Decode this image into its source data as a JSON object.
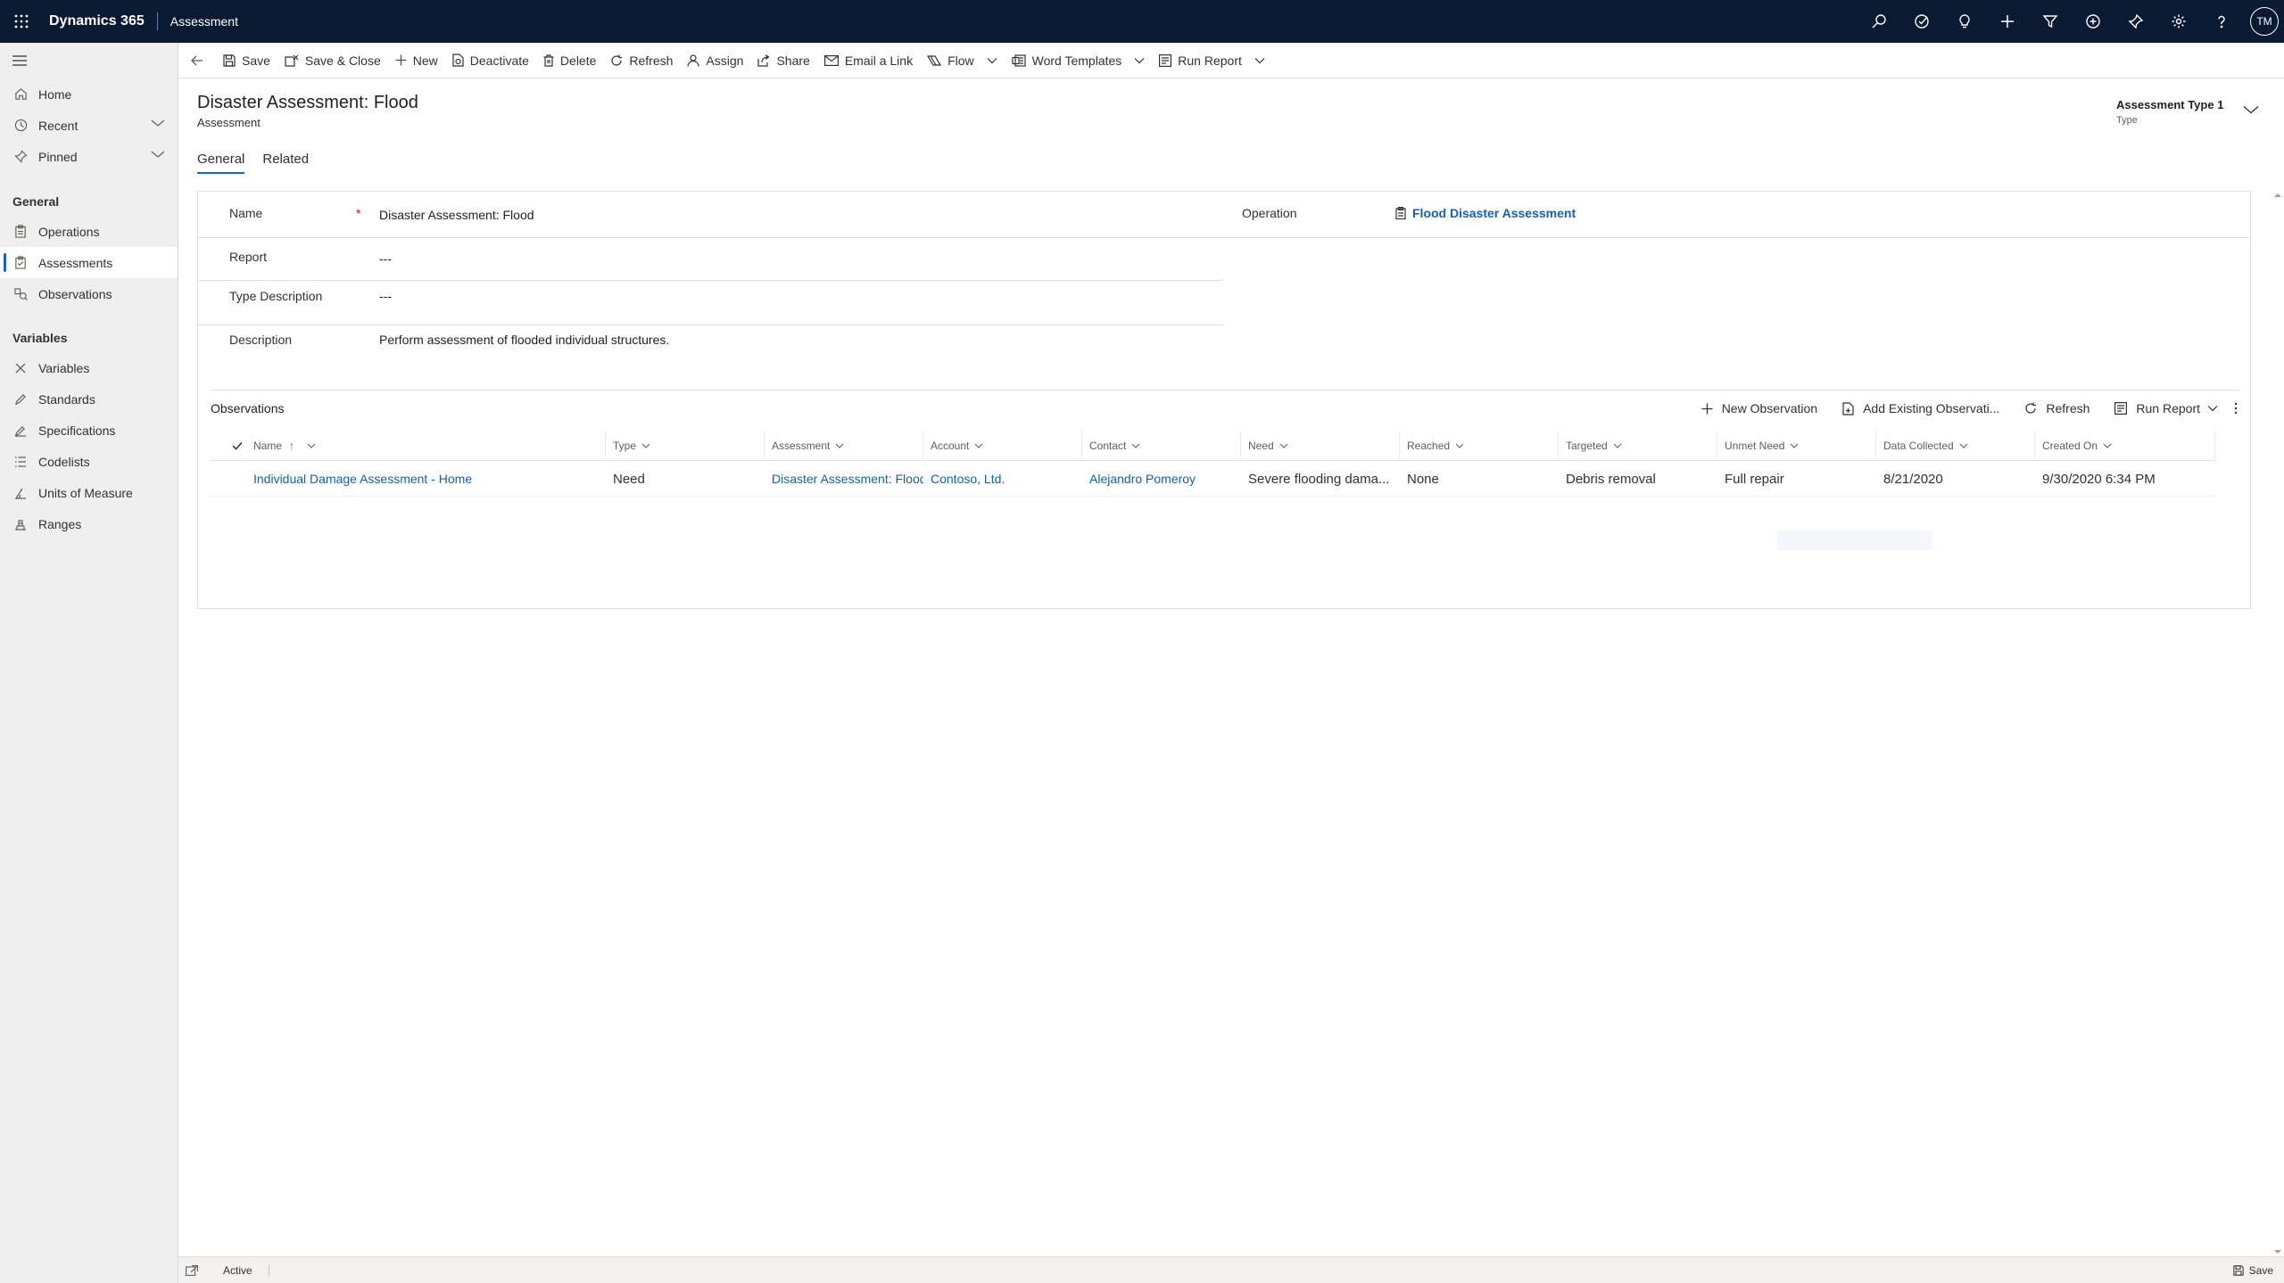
{
  "topbar": {
    "app_name": "Dynamics 365",
    "entity": "Assessment",
    "icons": [
      "search-icon",
      "task-icon",
      "lightbulb-icon",
      "plus-icon",
      "filter-icon",
      "add-circle-icon",
      "pin-icon",
      "gear-icon",
      "help-icon"
    ],
    "avatar_initials": "TM"
  },
  "sidebar": {
    "top_items": [
      {
        "label": "Home",
        "icon": "home-icon"
      },
      {
        "label": "Recent",
        "icon": "clock-icon"
      },
      {
        "label": "Pinned",
        "icon": "pin-icon"
      }
    ],
    "groups": [
      {
        "label": "General",
        "items": [
          {
            "label": "Operations",
            "icon": "clipboard-icon"
          },
          {
            "label": "Assessments",
            "icon": "assessment-icon",
            "active": true
          },
          {
            "label": "Observations",
            "icon": "observation-icon"
          }
        ]
      },
      {
        "label": "Variables",
        "items": [
          {
            "label": "Variables",
            "icon": "variable-icon"
          },
          {
            "label": "Standards",
            "icon": "pen-icon"
          },
          {
            "label": "Specifications",
            "icon": "specification-icon"
          },
          {
            "label": "Codelists",
            "icon": "list-icon"
          },
          {
            "label": "Units of Measure",
            "icon": "ruler-icon"
          },
          {
            "label": "Ranges",
            "icon": "range-icon"
          }
        ]
      }
    ]
  },
  "commandbar": {
    "items": [
      {
        "label": "Save",
        "icon": "save-icon"
      },
      {
        "label": "Save & Close",
        "icon": "save-close-icon"
      },
      {
        "label": "New",
        "icon": "plus-icon"
      },
      {
        "label": "Deactivate",
        "icon": "deactivate-icon"
      },
      {
        "label": "Delete",
        "icon": "trash-icon"
      },
      {
        "label": "Refresh",
        "icon": "refresh-icon"
      },
      {
        "label": "Assign",
        "icon": "person-icon"
      },
      {
        "label": "Share",
        "icon": "share-icon"
      },
      {
        "label": "Email a Link",
        "icon": "mail-icon"
      },
      {
        "label": "Flow",
        "icon": "flow-icon"
      },
      {
        "label": "Word Templates",
        "icon": "word-icon"
      },
      {
        "label": "Run Report",
        "icon": "report-icon"
      }
    ]
  },
  "record": {
    "title": "Disaster Assessment: Flood",
    "entity_label": "Assessment",
    "header_field_value": "Assessment Type 1",
    "header_field_label": "Type"
  },
  "tabs": [
    {
      "label": "General",
      "active": true
    },
    {
      "label": "Related",
      "active": false
    }
  ],
  "form": {
    "name_label": "Name",
    "name_required_marker": "*",
    "name_value": "Disaster Assessment: Flood",
    "report_label": "Report",
    "report_value": "---",
    "type_description_label": "Type Description",
    "type_description_value": "---",
    "description_label": "Description",
    "description_value": "Perform assessment of flooded individual structures.",
    "operation_label": "Operation",
    "operation_value": "Flood Disaster Assessment"
  },
  "observations": {
    "title": "Observations",
    "commands": {
      "new": "New Observation",
      "add_existing": "Add Existing Observati...",
      "refresh": "Refresh",
      "run_report": "Run Report"
    },
    "columns": [
      {
        "label": "Name",
        "sort": "↑"
      },
      {
        "label": "Type"
      },
      {
        "label": "Assessment"
      },
      {
        "label": "Account"
      },
      {
        "label": "Contact"
      },
      {
        "label": "Need"
      },
      {
        "label": "Reached"
      },
      {
        "label": "Targeted"
      },
      {
        "label": "Unmet Need"
      },
      {
        "label": "Data Collected"
      },
      {
        "label": "Created On"
      }
    ],
    "rows": [
      {
        "name": "Individual Damage Assessment - Home",
        "type": "Need",
        "assessment": "Disaster Assessment: Flood",
        "account": "Contoso, Ltd.",
        "contact": "Alejandro Pomeroy",
        "need": "Severe flooding dama...",
        "reached": "None",
        "targeted": "Debris removal",
        "unmet_need": "Full repair",
        "data_collected": "8/21/2020",
        "created_on": "9/30/2020 6:34 PM"
      }
    ]
  },
  "footer": {
    "status": "Active",
    "save_label": "Save"
  }
}
